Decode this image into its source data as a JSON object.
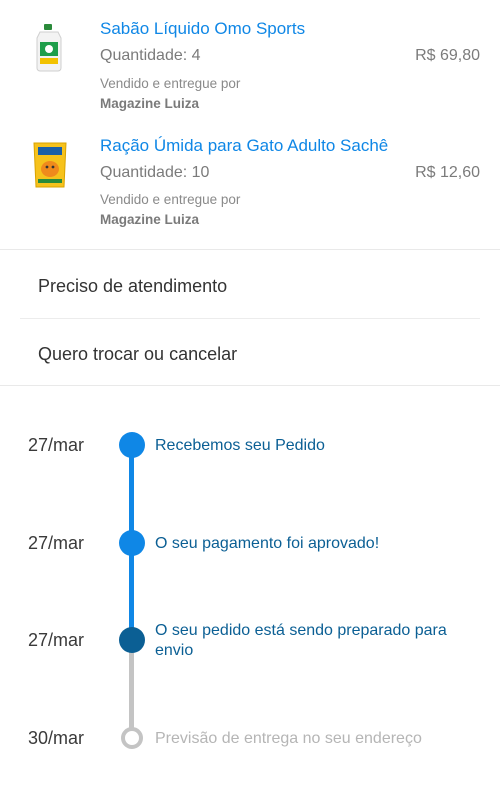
{
  "products": [
    {
      "name": "Sabão Líquido Omo Sports",
      "quantity": "Quantidade: 4",
      "price": "R$ 69,80",
      "sold_by": "Vendido e entregue por",
      "seller": "Magazine Luiza",
      "icon": "detergent-bottle-icon"
    },
    {
      "name": "Ração Úmida para Gato Adulto Sachê",
      "quantity": "Quantidade: 10",
      "price": "R$ 12,60",
      "sold_by": "Vendido e entregue por",
      "seller": "Magazine Luiza",
      "icon": "cat-food-sachet-icon"
    }
  ],
  "actions": {
    "support": "Preciso de atendimento",
    "exchange": "Quero trocar ou cancelar"
  },
  "timeline": [
    {
      "date": "27/mar",
      "text": "Recebemos seu Pedido",
      "status": "done"
    },
    {
      "date": "27/mar",
      "text": "O seu pagamento foi aprovado!",
      "status": "done"
    },
    {
      "date": "27/mar",
      "text": "O seu pedido está sendo preparado para envio",
      "status": "current"
    },
    {
      "date": "30/mar",
      "text": "Previsão de entrega no seu endereço",
      "status": "pending"
    }
  ],
  "colors": {
    "link_blue": "#0f87e6",
    "timeline_blue": "#0f87e6",
    "timeline_current": "#0b5f94",
    "timeline_pending": "#c4c4c4"
  }
}
